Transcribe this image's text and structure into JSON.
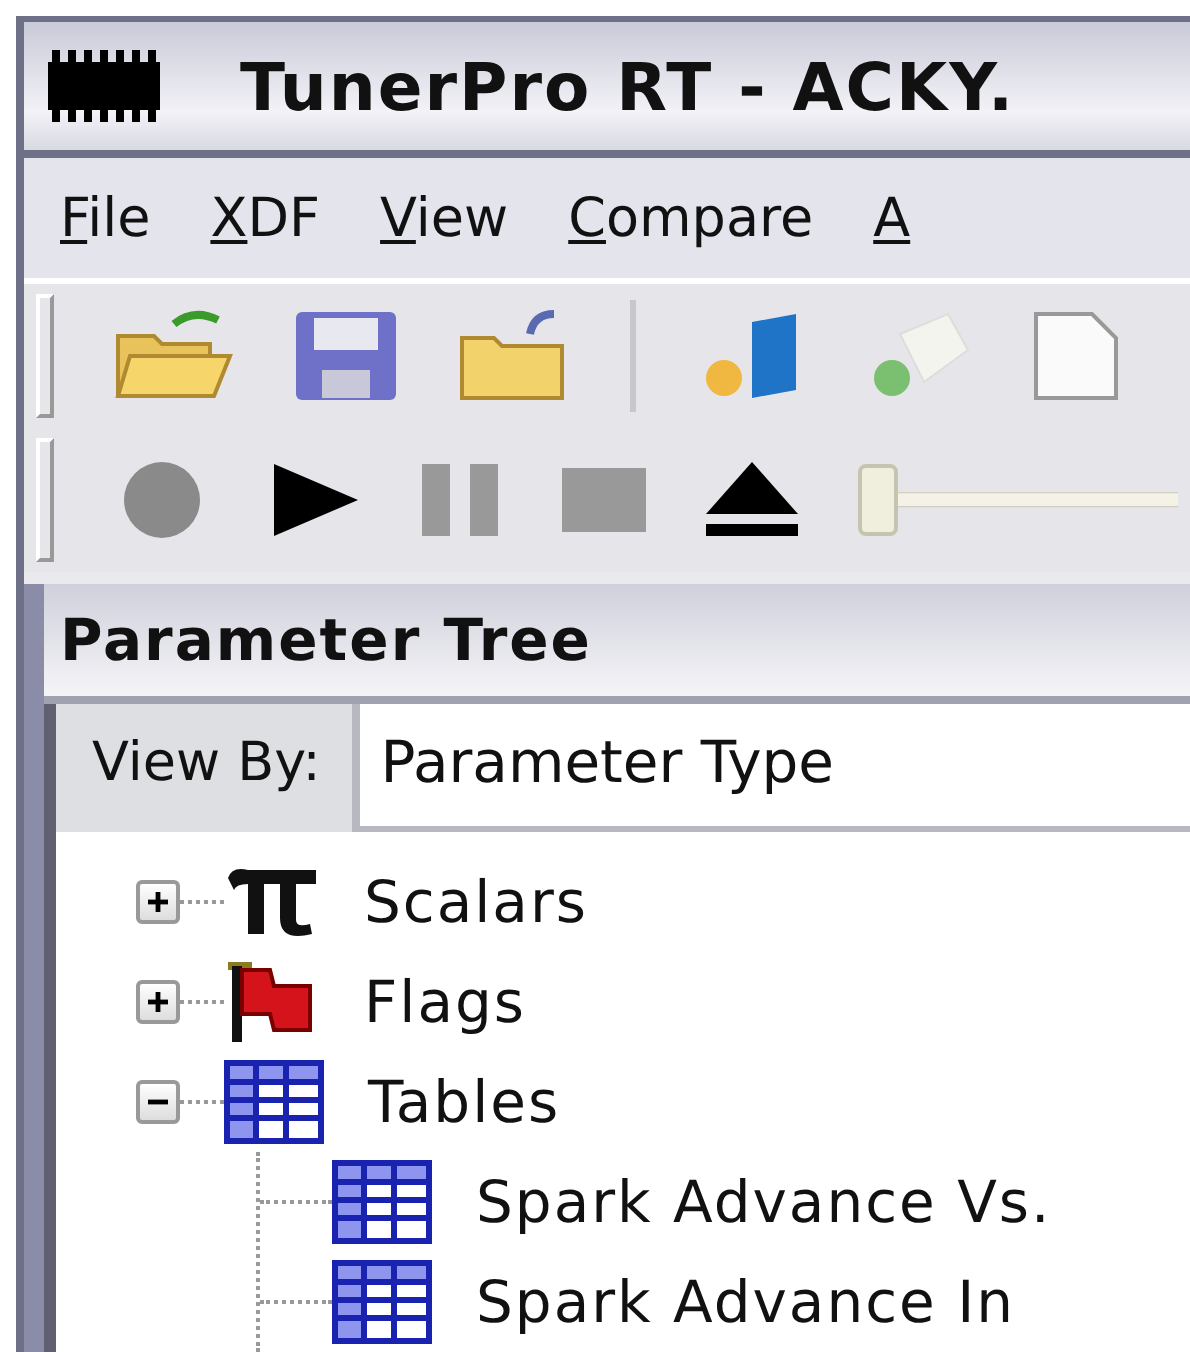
{
  "window": {
    "title": "TunerPro RT - ACKY."
  },
  "menu": [
    {
      "label": "File",
      "mnemonic_first": true
    },
    {
      "label": "XDF",
      "mnemonic_first": true
    },
    {
      "label": "View",
      "mnemonic_first": true
    },
    {
      "label": "Compare",
      "mnemonic_first": true
    },
    {
      "label": "A",
      "mnemonic_first": true
    }
  ],
  "player": {
    "slider": {
      "level": 0
    }
  },
  "panel": {
    "title": "Parameter Tree",
    "view_by": {
      "label": "View By:",
      "value": "Parameter Type"
    },
    "tree": [
      {
        "label": "Scalars",
        "kind": "scalar",
        "expanded": false
      },
      {
        "label": "Flags",
        "kind": "flag",
        "expanded": false
      },
      {
        "label": "Tables",
        "kind": "table",
        "expanded": true,
        "children": [
          {
            "label": "Spark Advance Vs. ",
            "kind": "table"
          },
          {
            "label": "Spark Advance  In ",
            "kind": "table"
          }
        ]
      }
    ]
  }
}
